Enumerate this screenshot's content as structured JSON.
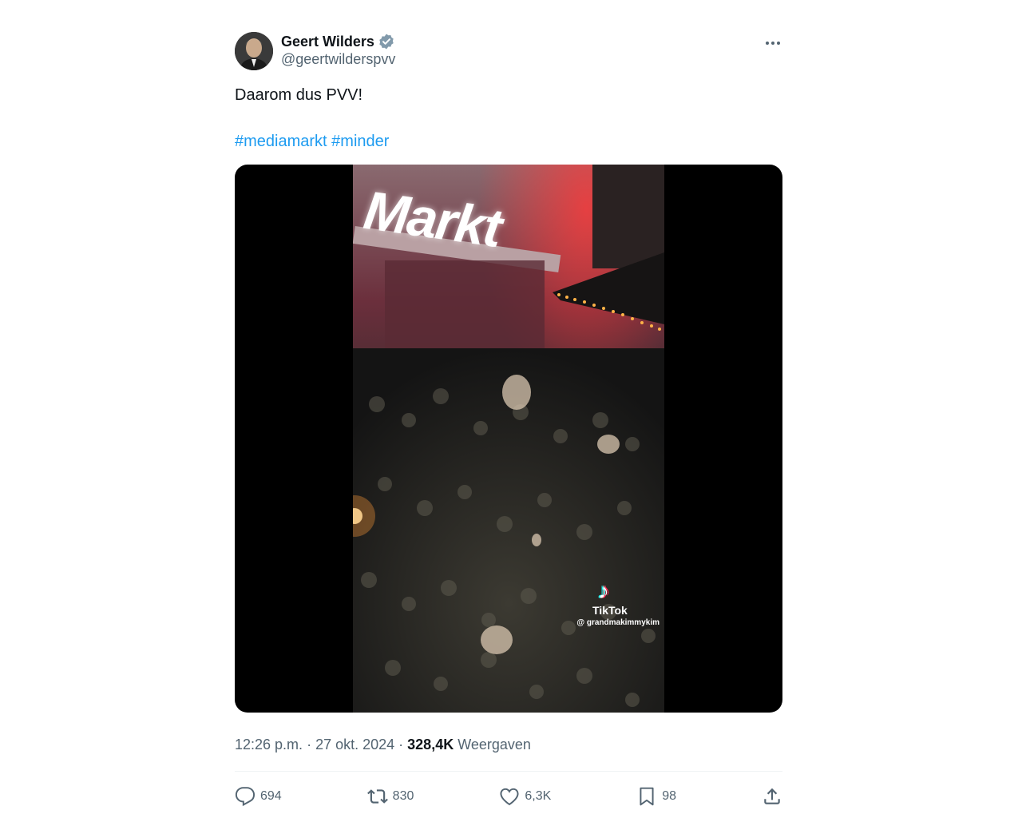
{
  "author": {
    "name": "Geert Wilders",
    "handle": "@geertwilderspvv",
    "verified": true
  },
  "tweet": {
    "text": "Daarom dus PVV!",
    "hashtags": [
      "#mediamarkt",
      "#minder"
    ]
  },
  "media": {
    "overlay_brand": "TikTok",
    "overlay_user": "@ grandmakimmykim",
    "sign_text": "Markt"
  },
  "meta": {
    "time": "12:26 p.m.",
    "date": "27 okt. 2024",
    "views_count": "328,4K",
    "views_label": "Weergaven"
  },
  "actions": {
    "replies": "694",
    "reposts": "830",
    "likes": "6,3K",
    "bookmarks": "98"
  },
  "colors": {
    "link": "#1d9bf0",
    "secondary_text": "#536471",
    "verified": "#829aab"
  },
  "icons": [
    "more-icon",
    "verified-badge-icon",
    "reply-icon",
    "repost-icon",
    "like-icon",
    "bookmark-icon",
    "share-icon"
  ]
}
